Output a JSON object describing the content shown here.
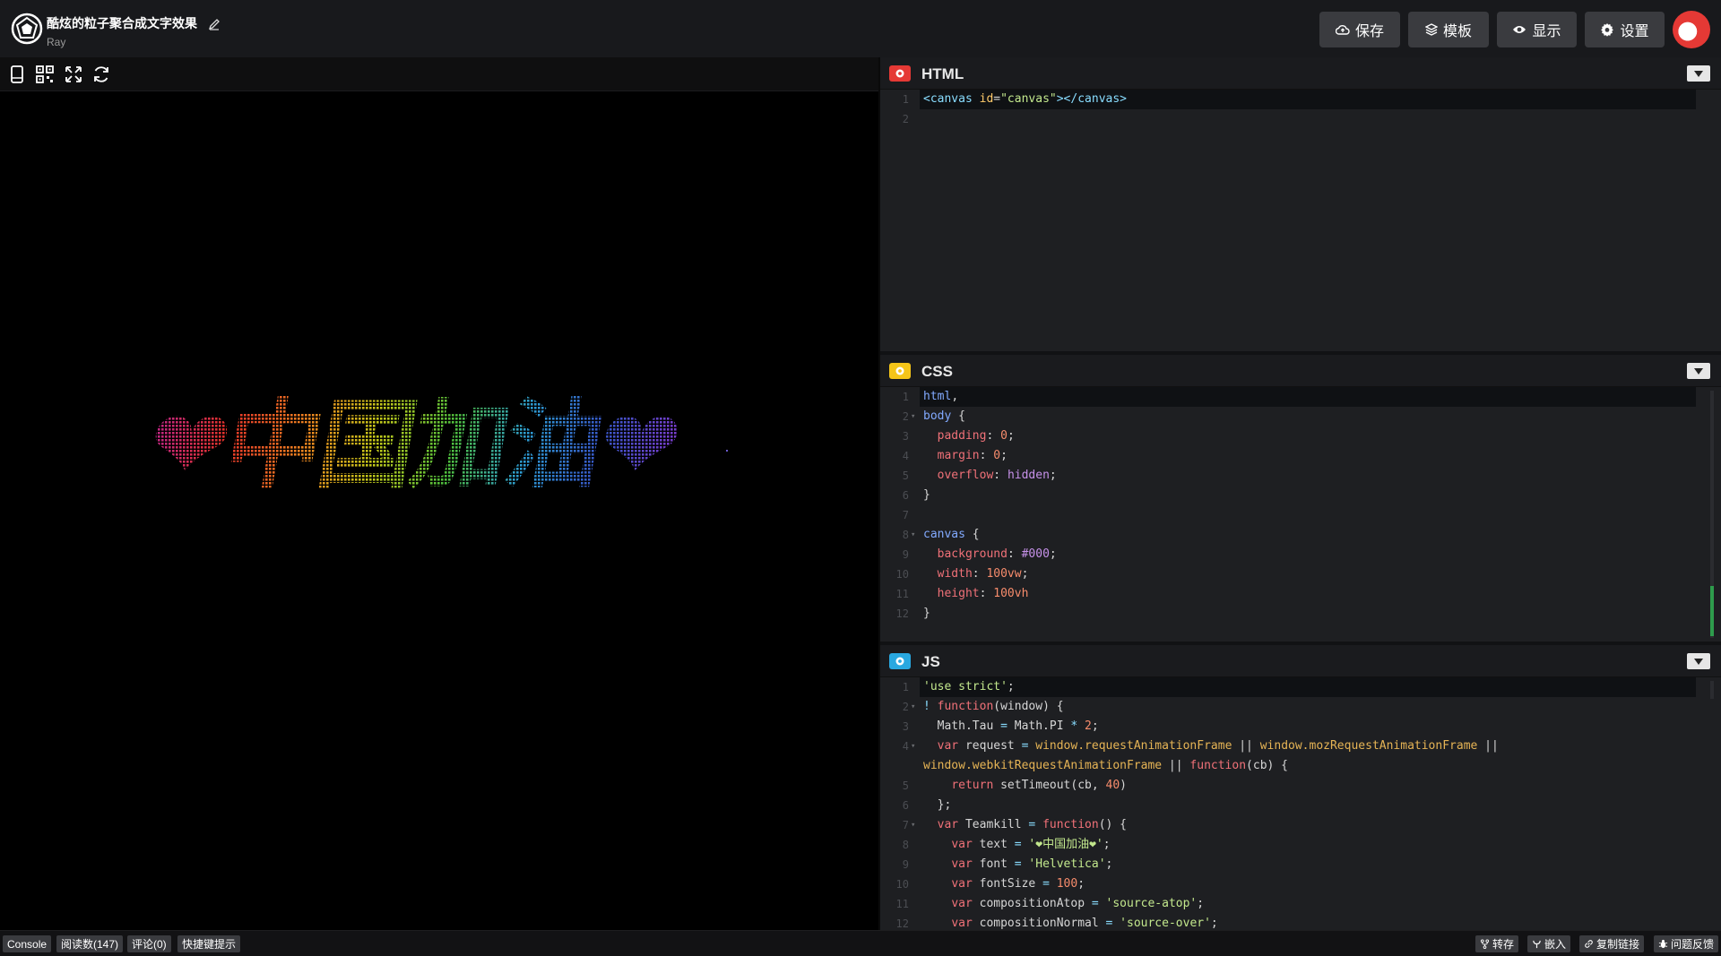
{
  "header": {
    "title": "酷炫的粒子聚合成文字效果",
    "author": "Ray",
    "buttons": {
      "save": "保存",
      "template": "模板",
      "display": "显示",
      "settings": "设置"
    }
  },
  "preview": {
    "text": "❤中国加油❤",
    "colors": [
      "#c0258a",
      "#e5332a",
      "#f08020",
      "#c4c81a",
      "#4fbf3c",
      "#2d9bd2",
      "#3856c8",
      "#7a3ccc"
    ]
  },
  "panels": {
    "html": {
      "title": "HTML",
      "badge_color": "#e53935",
      "lines": [
        [
          [
            "tag",
            "<canvas "
          ],
          [
            "attr",
            "id"
          ],
          [
            "plain",
            "="
          ],
          [
            "str",
            "\"canvas\""
          ],
          [
            "tag",
            "></canvas>"
          ]
        ],
        []
      ]
    },
    "css": {
      "title": "CSS",
      "badge_color": "#f5c518",
      "lines": [
        [
          [
            "sel",
            "html"
          ],
          [
            "plain",
            ","
          ]
        ],
        [
          [
            "sel",
            "body"
          ],
          [
            "plain",
            " {"
          ]
        ],
        [
          [
            "plain",
            "  "
          ],
          [
            "prop",
            "padding"
          ],
          [
            "plain",
            ": "
          ],
          [
            "num",
            "0"
          ],
          [
            "plain",
            ";"
          ]
        ],
        [
          [
            "plain",
            "  "
          ],
          [
            "prop",
            "margin"
          ],
          [
            "plain",
            ": "
          ],
          [
            "num",
            "0"
          ],
          [
            "plain",
            ";"
          ]
        ],
        [
          [
            "plain",
            "  "
          ],
          [
            "prop",
            "overflow"
          ],
          [
            "plain",
            ": "
          ],
          [
            "val",
            "hidden"
          ],
          [
            "plain",
            ";"
          ]
        ],
        [
          [
            "plain",
            "}"
          ]
        ],
        [],
        [
          [
            "sel",
            "canvas"
          ],
          [
            "plain",
            " {"
          ]
        ],
        [
          [
            "plain",
            "  "
          ],
          [
            "prop",
            "background"
          ],
          [
            "plain",
            ": "
          ],
          [
            "val",
            "#000"
          ],
          [
            "plain",
            ";"
          ]
        ],
        [
          [
            "plain",
            "  "
          ],
          [
            "prop",
            "width"
          ],
          [
            "plain",
            ": "
          ],
          [
            "num",
            "100vw"
          ],
          [
            "plain",
            ";"
          ]
        ],
        [
          [
            "plain",
            "  "
          ],
          [
            "prop",
            "height"
          ],
          [
            "plain",
            ": "
          ],
          [
            "num",
            "100vh"
          ]
        ],
        [
          [
            "plain",
            "}"
          ]
        ]
      ]
    },
    "js": {
      "title": "JS",
      "badge_color": "#29a8e0",
      "lines": [
        [
          [
            "str",
            "'use strict'"
          ],
          [
            "plain",
            ";"
          ]
        ],
        [
          [
            "pl",
            "!"
          ],
          [
            "plain",
            " "
          ],
          [
            "kw",
            "function"
          ],
          [
            "plain",
            "(window) {"
          ]
        ],
        [
          [
            "plain",
            "  Math.Tau "
          ],
          [
            "pl",
            "="
          ],
          [
            "plain",
            " Math.PI "
          ],
          [
            "pl",
            "*"
          ],
          [
            "plain",
            " "
          ],
          [
            "num",
            "2"
          ],
          [
            "plain",
            ";"
          ]
        ],
        [
          [
            "plain",
            "  "
          ],
          [
            "kw",
            "var"
          ],
          [
            "plain",
            " request "
          ],
          [
            "pl",
            "="
          ],
          [
            "plain",
            " "
          ],
          [
            "fn",
            "window.requestAnimationFrame"
          ],
          [
            "plain",
            " || "
          ],
          [
            "fn",
            "window.mozRequestAnimationFrame"
          ],
          [
            "plain",
            " ||"
          ]
        ],
        [
          [
            "fn",
            "window.webkitRequestAnimationFrame"
          ],
          [
            "plain",
            " || "
          ],
          [
            "kw",
            "function"
          ],
          [
            "plain",
            "(cb) {"
          ]
        ],
        [
          [
            "plain",
            "    "
          ],
          [
            "kw",
            "return"
          ],
          [
            "plain",
            " setTimeout(cb, "
          ],
          [
            "num",
            "40"
          ],
          [
            "plain",
            ")"
          ]
        ],
        [
          [
            "plain",
            "  };"
          ]
        ],
        [
          [
            "plain",
            "  "
          ],
          [
            "kw",
            "var"
          ],
          [
            "plain",
            " Teamkill "
          ],
          [
            "pl",
            "="
          ],
          [
            "plain",
            " "
          ],
          [
            "kw",
            "function"
          ],
          [
            "plain",
            "() {"
          ]
        ],
        [
          [
            "plain",
            "    "
          ],
          [
            "kw",
            "var"
          ],
          [
            "plain",
            " text "
          ],
          [
            "pl",
            "="
          ],
          [
            "plain",
            " "
          ],
          [
            "str",
            "'❤中国加油❤'"
          ],
          [
            "plain",
            ";"
          ]
        ],
        [
          [
            "plain",
            "    "
          ],
          [
            "kw",
            "var"
          ],
          [
            "plain",
            " font "
          ],
          [
            "pl",
            "="
          ],
          [
            "plain",
            " "
          ],
          [
            "str",
            "'Helvetica'"
          ],
          [
            "plain",
            ";"
          ]
        ],
        [
          [
            "plain",
            "    "
          ],
          [
            "kw",
            "var"
          ],
          [
            "plain",
            " fontSize "
          ],
          [
            "pl",
            "="
          ],
          [
            "plain",
            " "
          ],
          [
            "num",
            "100"
          ],
          [
            "plain",
            ";"
          ]
        ],
        [
          [
            "plain",
            "    "
          ],
          [
            "kw",
            "var"
          ],
          [
            "plain",
            " compositionAtop "
          ],
          [
            "pl",
            "="
          ],
          [
            "plain",
            " "
          ],
          [
            "str",
            "'source-atop'"
          ],
          [
            "plain",
            ";"
          ]
        ],
        [
          [
            "plain",
            "    "
          ],
          [
            "kw",
            "var"
          ],
          [
            "plain",
            " compositionNormal "
          ],
          [
            "pl",
            "="
          ],
          [
            "plain",
            " "
          ],
          [
            "str",
            "'source-over'"
          ],
          [
            "plain",
            ";"
          ]
        ]
      ],
      "line_numbers": [
        "1",
        "2",
        "3",
        "4",
        "",
        "5",
        "6",
        "7",
        "8",
        "9",
        "10",
        "11",
        "12"
      ]
    }
  },
  "footer": {
    "left": [
      "Console",
      "阅读数(147)",
      "评论(0)",
      "快捷键提示"
    ],
    "right": [
      "转存",
      "嵌入",
      "复制链接",
      "问题反馈"
    ]
  }
}
